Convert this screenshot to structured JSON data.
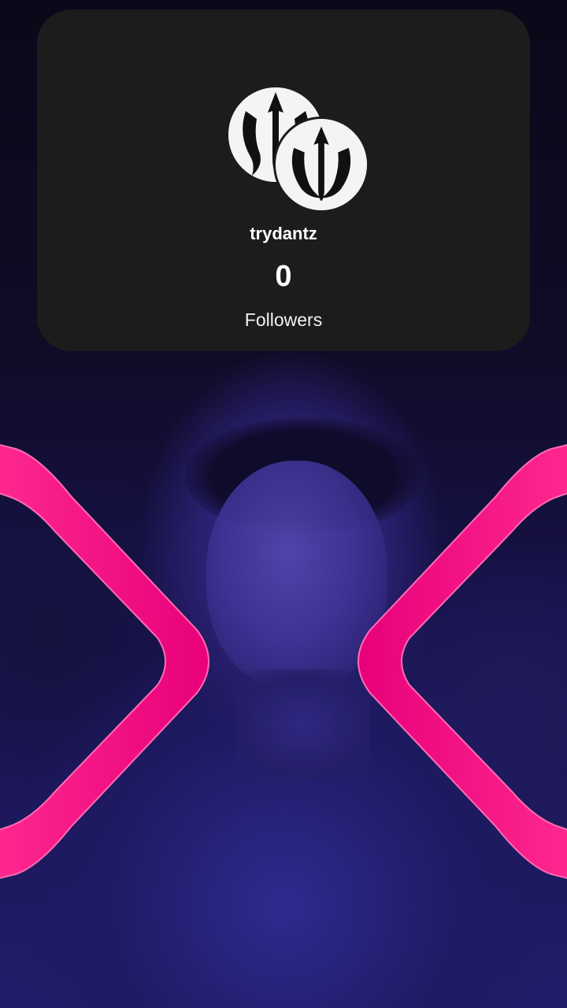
{
  "profile": {
    "username": "trydantz",
    "follower_count": "0",
    "follower_label": "Followers",
    "avatar_icon": "trident-logo-icon"
  },
  "colors": {
    "card_background": "#1c1c1c",
    "overlay_accent": "#ff1a8c",
    "text": "#ffffff"
  }
}
